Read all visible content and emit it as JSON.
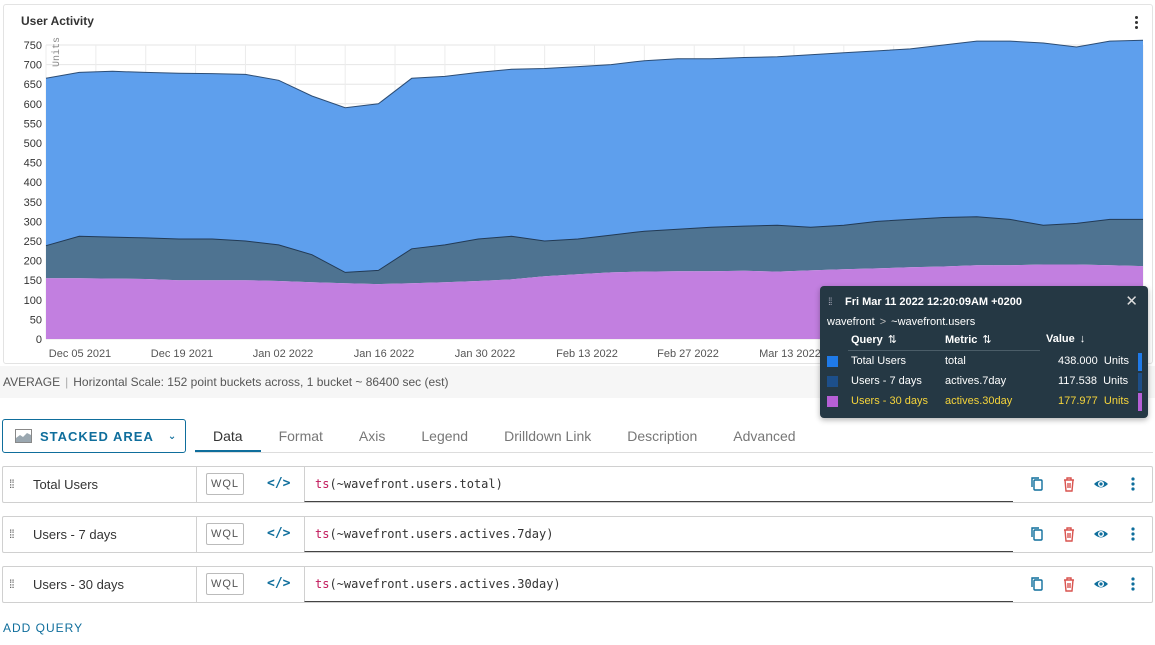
{
  "chart": {
    "title": "User Activity",
    "y_unit": "Units",
    "menu_icon": "kebab-icon"
  },
  "chart_data": {
    "type": "area",
    "stacked": true,
    "title": "User Activity",
    "ylabel": "Units",
    "ylim": [
      0,
      750
    ],
    "yticks": [
      0,
      50,
      100,
      150,
      200,
      250,
      300,
      350,
      400,
      450,
      500,
      550,
      600,
      650,
      700,
      750
    ],
    "x_tick_labels": [
      "Dec 05 2021",
      "Dec 19 2021",
      "Jan 02 2022",
      "Jan 16 2022",
      "Jan 30 2022",
      "Feb 13 2022",
      "Feb 27 2022",
      "Mar 13 2022"
    ],
    "grid": true,
    "series": [
      {
        "name": "Users - 30 days",
        "color": "#c27fe0",
        "values": [
          155,
          155,
          154,
          153,
          150,
          150,
          150,
          148,
          145,
          142,
          140,
          142,
          145,
          148,
          152,
          160,
          165,
          170,
          172,
          173,
          173,
          174,
          172,
          175,
          178,
          180,
          183,
          185,
          188,
          188,
          190,
          190,
          188,
          186
        ]
      },
      {
        "name": "Users - 7 days",
        "color": "#4e7391",
        "cumulative": [
          238,
          262,
          260,
          258,
          255,
          255,
          250,
          240,
          215,
          170,
          175,
          230,
          240,
          255,
          262,
          250,
          255,
          265,
          275,
          280,
          285,
          288,
          290,
          285,
          290,
          300,
          305,
          310,
          312,
          305,
          290,
          295,
          305,
          305
        ]
      },
      {
        "name": "Total Users",
        "color": "#5e9fed",
        "cumulative": [
          665,
          680,
          683,
          680,
          678,
          677,
          675,
          660,
          620,
          590,
          600,
          665,
          670,
          680,
          688,
          690,
          695,
          700,
          710,
          715,
          715,
          718,
          720,
          725,
          730,
          735,
          740,
          750,
          760,
          760,
          755,
          745,
          760,
          762
        ]
      }
    ]
  },
  "status": {
    "mode": "AVERAGE",
    "scale_text": "Horizontal Scale: 152 point buckets across, 1 bucket ~ 86400 sec (est)"
  },
  "tooltip": {
    "date": "Fri Mar 11 2022 12:20:09AM +0200",
    "path_source": "wavefront",
    "path_metric": "~wavefront.users",
    "col_query": "Query",
    "col_metric": "Metric",
    "col_value": "Value",
    "rows": [
      {
        "query": "Total Users",
        "metric": "total",
        "value": "438.000",
        "unit": "Units",
        "color": "#1f7ae8"
      },
      {
        "query": "Users - 7 days",
        "metric": "actives.7day",
        "value": "117.538",
        "unit": "Units",
        "color": "#1d4f8a"
      },
      {
        "query": "Users - 30 days",
        "metric": "actives.30day",
        "value": "177.977",
        "unit": "Units",
        "color": "#b65fd6"
      }
    ]
  },
  "chart_type_button": {
    "label": "STACKED AREA",
    "icon": "area-chart-icon"
  },
  "tabs": [
    {
      "label": "Data",
      "active": true
    },
    {
      "label": "Format"
    },
    {
      "label": "Axis"
    },
    {
      "label": "Legend"
    },
    {
      "label": "Drilldown Link"
    },
    {
      "label": "Description"
    },
    {
      "label": "Advanced"
    }
  ],
  "queries": [
    {
      "name": "Total Users",
      "mode": "WQL",
      "fn": "ts",
      "arg": "(~wavefront.users.total)"
    },
    {
      "name": "Users - 7 days",
      "mode": "WQL",
      "fn": "ts",
      "arg": "(~wavefront.users.actives.7day)"
    },
    {
      "name": "Users - 30 days",
      "mode": "WQL",
      "fn": "ts",
      "arg": "(~wavefront.users.actives.30day)"
    }
  ],
  "add_query_label": "ADD QUERY",
  "colors": {
    "accent": "#0f6e9c",
    "danger": "#d9534f",
    "tooltip_bg": "#253844"
  }
}
